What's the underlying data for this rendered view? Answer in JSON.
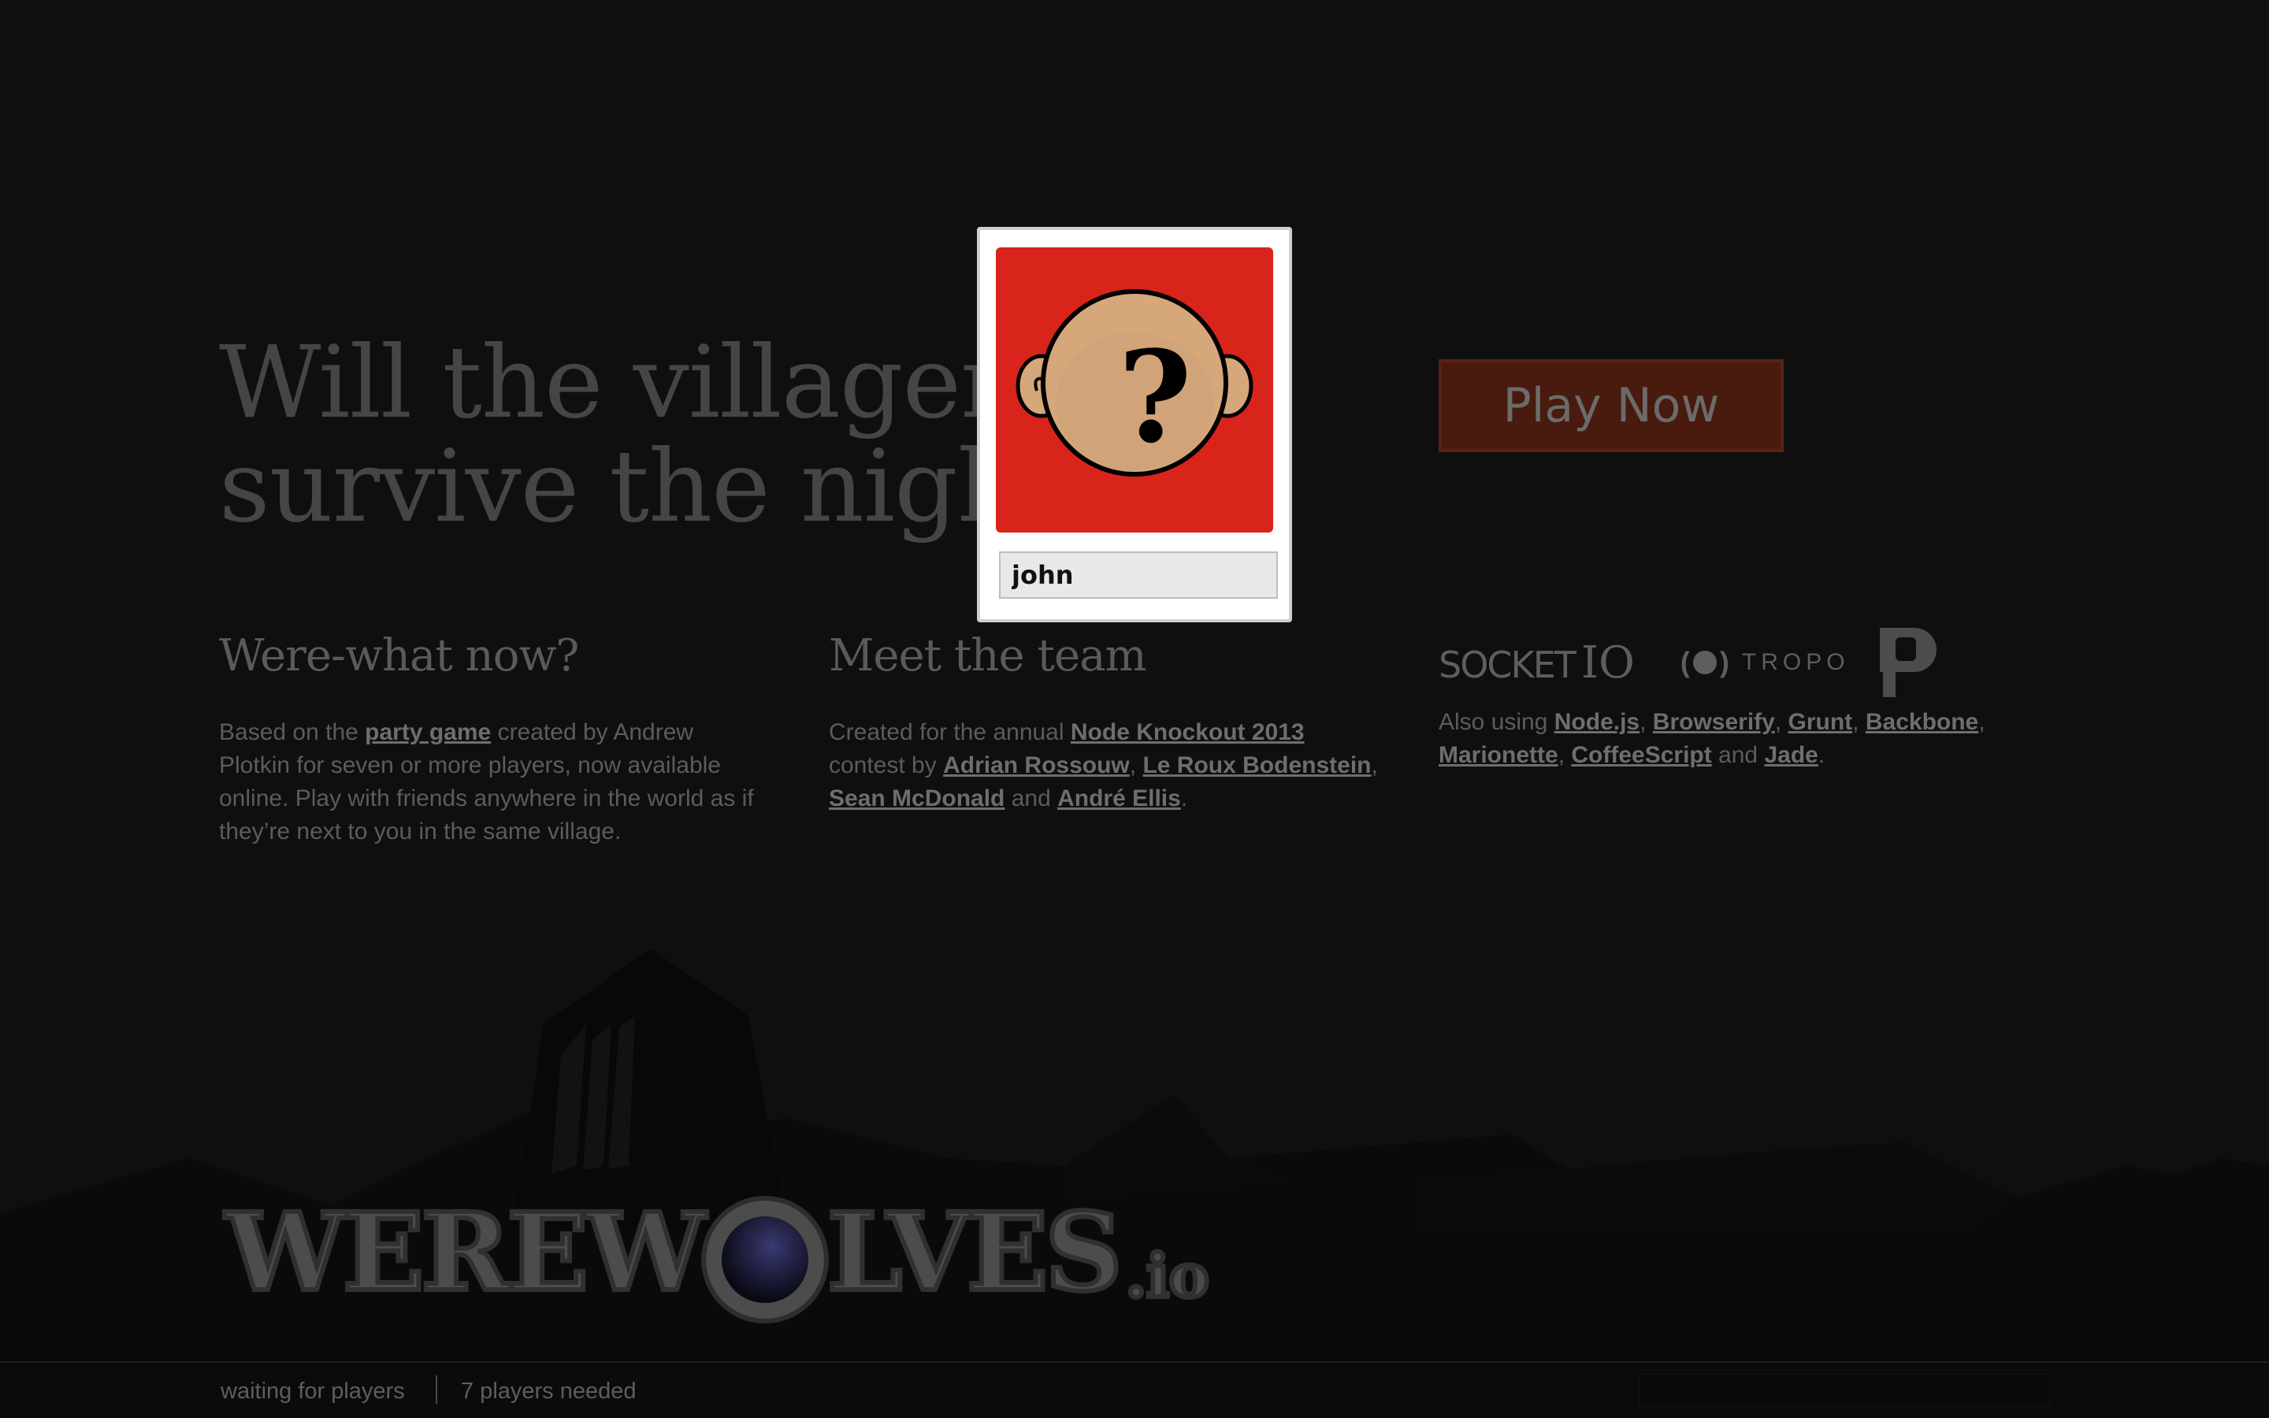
{
  "hero": {
    "title": "Will the villagers survive the night?",
    "play_button": "Play Now"
  },
  "about": {
    "heading": "Were-what now?",
    "text_1": "Based on the ",
    "link_1": "party game",
    "text_2": " created by Andrew Plotkin for seven or more players, now available online. Play with friends anywhere in the world as if they’re next to you in the same village."
  },
  "team": {
    "heading": "Meet the team",
    "text_1": "Created for the annual ",
    "link_event": "Node Knockout 2013",
    "text_2": " contest by ",
    "member_1": "Adrian Rossouw",
    "sep_1": ", ",
    "member_2": "Le Roux Bodenstein",
    "sep_2": ", ",
    "member_3": "Sean McDonald",
    "sep_3": " and ",
    "member_4": "André Ellis",
    "end": "."
  },
  "tech": {
    "logo_socket": "SOCKET",
    "logo_socket_io": "IO",
    "logo_tropo": "TROPO",
    "text_1": "Also using ",
    "link_1": "Node.js",
    "link_2": "Browserify",
    "link_3": "Grunt",
    "link_4": "Backbone",
    "link_5": "Marionette",
    "link_6": "CoffeeScript",
    "and": " and ",
    "link_7": "Jade",
    "comma": ", ",
    "end": "."
  },
  "brand": {
    "part_1": "WEREW",
    "part_2": "LVES",
    "tld": ".io"
  },
  "status": {
    "state": "waiting for players",
    "needed": "7 players needed"
  },
  "card": {
    "avatar_symbol": "?",
    "name": "john"
  },
  "colors": {
    "background": "#0f0f10",
    "play_button": "#491a0e",
    "avatar_bg": "#d9241c"
  }
}
